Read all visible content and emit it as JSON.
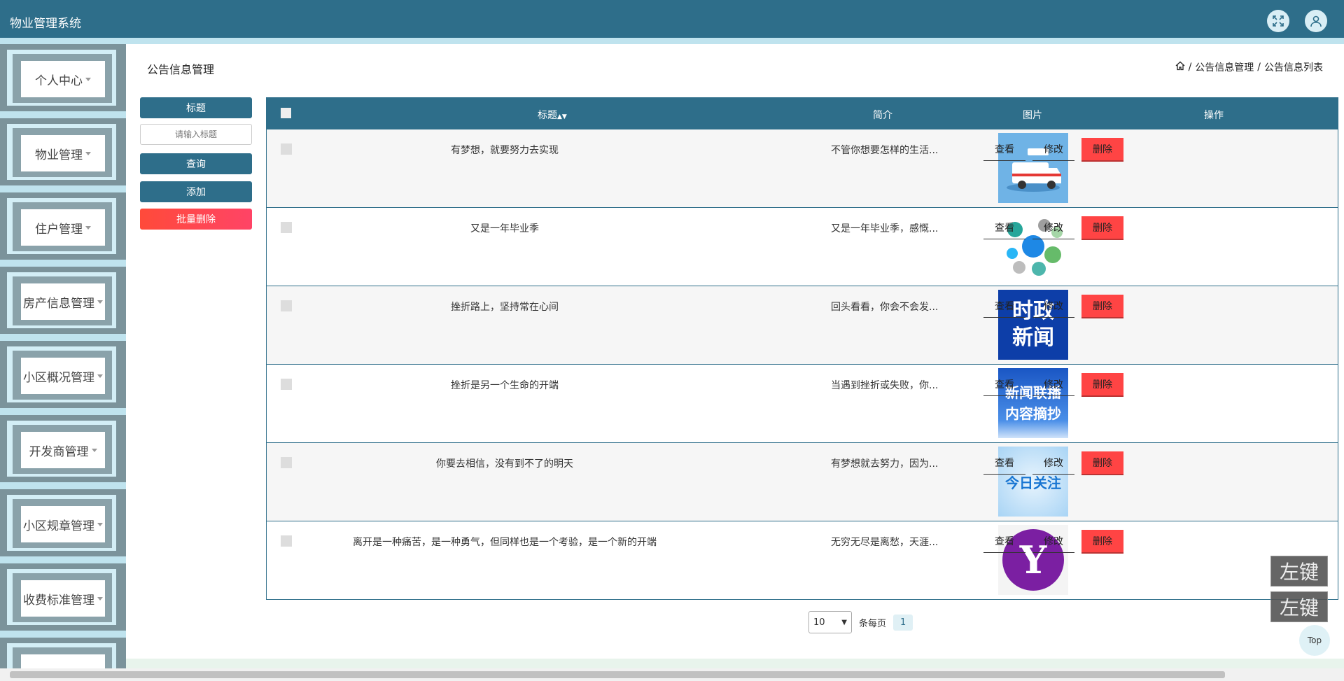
{
  "app": {
    "title": "物业管理系统"
  },
  "header": {
    "icons": [
      "fullscreen-icon",
      "user-icon"
    ]
  },
  "sidebar": {
    "items": [
      {
        "label": "个人中心"
      },
      {
        "label": "物业管理"
      },
      {
        "label": "住户管理"
      },
      {
        "label": "房产信息管理"
      },
      {
        "label": "小区概况管理"
      },
      {
        "label": "开发商管理"
      },
      {
        "label": "小区规章管理"
      },
      {
        "label": "收费标准管理"
      }
    ]
  },
  "page": {
    "title": "公告信息管理",
    "breadcrumb": [
      "公告信息管理",
      "公告信息列表"
    ],
    "separator": "/"
  },
  "filters": {
    "title_label": "标题",
    "title_placeholder": "请输入标题",
    "query_button": "查询",
    "add_button": "添加",
    "batch_delete_button": "批量删除"
  },
  "table": {
    "headers": {
      "title": "标题",
      "intro": "简介",
      "image": "图片",
      "actions": "操作"
    },
    "rows": [
      {
        "title": "有梦想，就要努力去实现",
        "intro": "不管你想要怎样的生活...",
        "image": "ambulance-illustration"
      },
      {
        "title": "又是一年毕业季",
        "intro": "又是一年毕业季，感慨...",
        "image": "bubble-diagram"
      },
      {
        "title": "挫折路上，坚持常在心间",
        "intro": "回头看看，你会不会发...",
        "image": "news-poster",
        "image_text": "时政\n新闻"
      },
      {
        "title": "挫折是另一个生命的开端",
        "intro": "当遇到挫折或失败，你...",
        "image": "news-digest-poster",
        "image_text": "新闻联播\n内容摘抄"
      },
      {
        "title": "你要去相信，没有到不了的明天",
        "intro": "有梦想就去努力，因为...",
        "image": "today-focus-poster",
        "image_text": "今日关注"
      },
      {
        "title": "离开是一种痛苦，是一种勇气，但同样也是一个考验，是一个新的开端",
        "intro": "无穷无尽是离愁，天涯...",
        "image": "yahoo-logo",
        "image_text": "Y"
      }
    ],
    "actions": {
      "view": "查看",
      "edit": "修改",
      "delete": "删除"
    }
  },
  "pagination": {
    "page_size": "10",
    "per_page_label": "条每页",
    "current_page": "1"
  },
  "overlays": {
    "label_1": "左键",
    "label_2": "左键"
  },
  "back_to_top": "Top",
  "colors": {
    "primary": "#2e6e8a",
    "danger": "#ff4444",
    "sidebar_bg": "#bfe3ee"
  }
}
